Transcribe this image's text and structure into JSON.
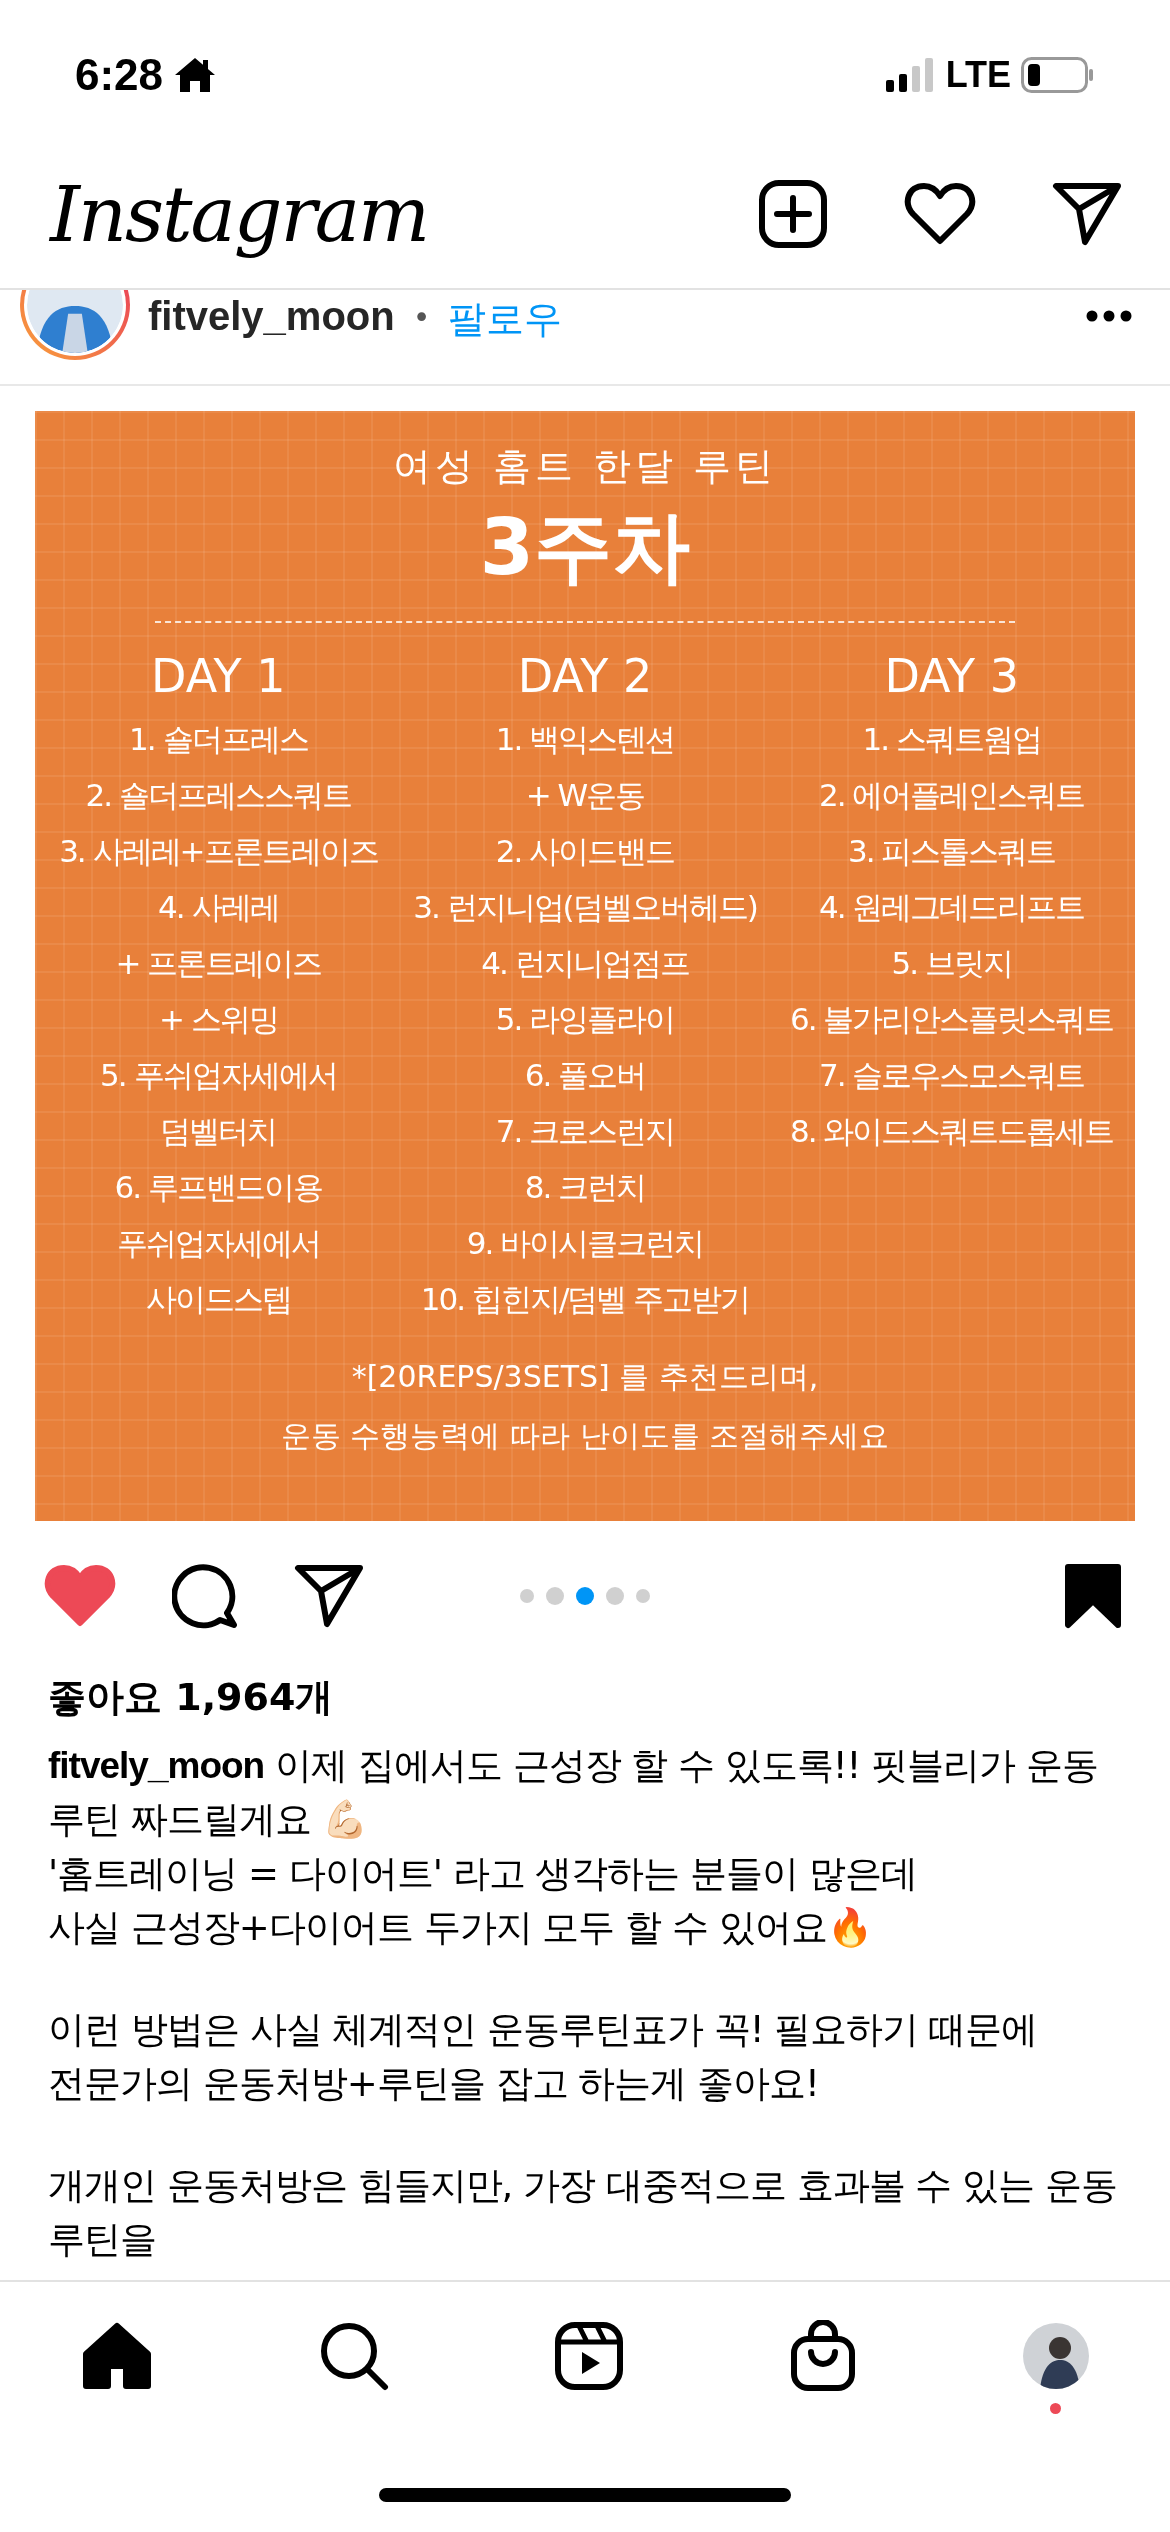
{
  "status_bar": {
    "time": "6:28",
    "network": "LTE"
  },
  "header": {
    "logo": "Instagram"
  },
  "post": {
    "username": "fitvely_moon",
    "separator": "•",
    "follow": "팔로우",
    "image": {
      "subtitle": "여성 홈트 한달 루틴",
      "title": "3주차",
      "days": [
        {
          "heading": "DAY 1",
          "lines": [
            "1. 숄더프레스",
            "2. 숄더프레스스쿼트",
            "3. 사레레+프론트레이즈",
            "4. 사레레",
            "+ 프론트레이즈",
            "+ 스위밍",
            "5. 푸쉬업자세에서",
            "덤벨터치",
            "6. 루프밴드이용",
            "푸쉬업자세에서",
            "사이드스텝"
          ]
        },
        {
          "heading": "DAY 2",
          "lines": [
            "1. 백익스텐션",
            "+ W운동",
            "2. 사이드밴드",
            "3. 런지니업(덤벨오버헤드)",
            "4. 런지니업점프",
            "5. 라잉플라이",
            "6. 풀오버",
            "7. 크로스런지",
            "8. 크런치",
            "9. 바이시클크런치",
            "10. 힙힌지/덤벨 주고받기"
          ]
        },
        {
          "heading": "DAY 3",
          "lines": [
            "1. 스쿼트웜업",
            "2. 에어플레인스쿼트",
            "3. 피스톨스쿼트",
            "4. 원레그데드리프트",
            "5. 브릿지",
            "6. 불가리안스플릿스쿼트",
            "7. 슬로우스모스쿼트",
            "8. 와이드스쿼트드롭세트"
          ]
        }
      ],
      "notes": [
        "*[20REPS/3SETS] 를 추천드리며,",
        "운동 수행능력에 따라 난이도를 조절해주세요"
      ]
    },
    "liked": true,
    "saved": true,
    "carousel_dots": [
      {
        "selected": false
      },
      {
        "selected": false
      },
      {
        "selected": true
      },
      {
        "selected": false
      },
      {
        "selected": false
      }
    ],
    "likes": "좋아요 1,964개",
    "caption_username": "fitvely_moon",
    "caption": [
      [
        "이제 집에서도 근성장 할 수 있도록!! 핏블리가 운동루틴 짜드릴게요 💪🏻",
        "'홈트레이닝 = 다이어트' 라고 생각하는 분들이 많은데",
        "사실 근성장+다이어트 두가지 모두 할 수 있어요🔥"
      ],
      [
        "이런 방법은 사실 체계적인 운동루틴표가 꼭! 필요하기 때문에",
        "전문가의 운동처방+루틴을 잡고 하는게 좋아요!"
      ],
      [
        "개개인 운동처방은 힘들지만, 가장 대중적으로 효과볼 수 있는 운동루틴을"
      ]
    ]
  },
  "tab_bar": {
    "tabs": [
      {
        "kind": "home",
        "selected": true
      },
      {
        "kind": "search",
        "selected": false
      },
      {
        "kind": "reels",
        "selected": false
      },
      {
        "kind": "shop",
        "selected": false
      },
      {
        "kind": "profile",
        "selected": false
      }
    ],
    "profile_notification": true
  }
}
